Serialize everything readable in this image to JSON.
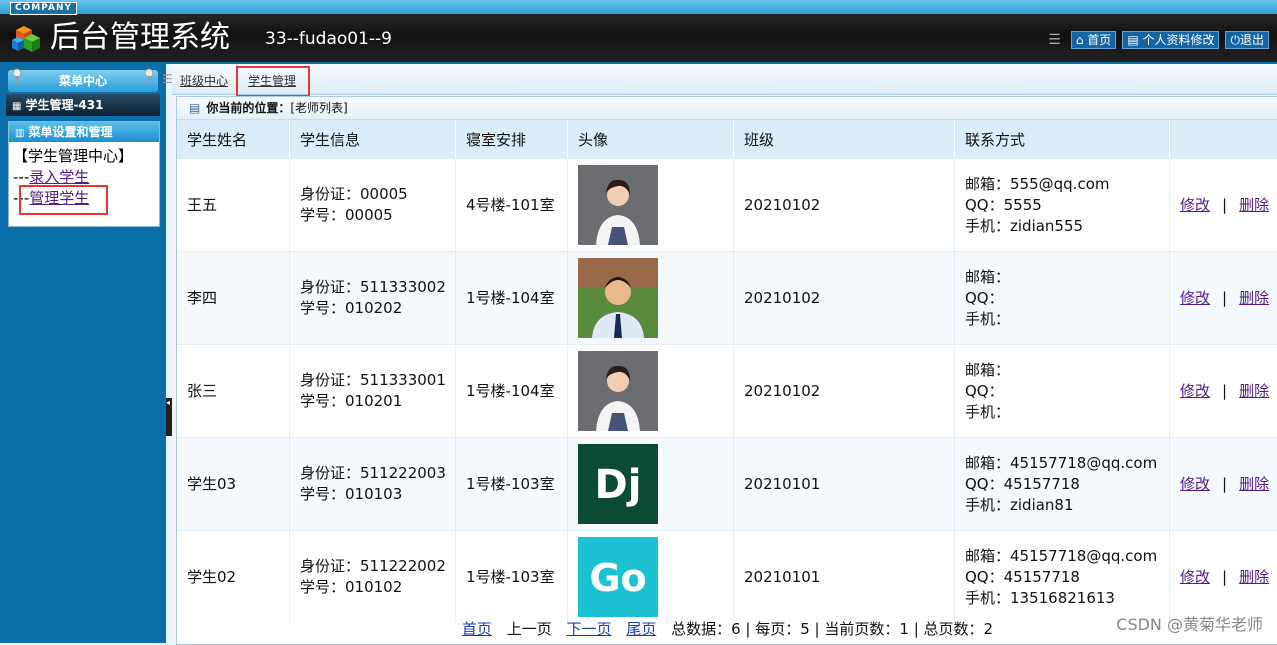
{
  "header": {
    "company": "COMPANY",
    "title": "后台管理系统",
    "user": "33--fudao01--9",
    "links": [
      "首页",
      "个人资料修改",
      "退出"
    ]
  },
  "sidebar": {
    "menu_center": "菜单中心",
    "module": "学生管理-431",
    "panel_title": "菜单设置和管理",
    "root": "【学生管理中心】",
    "items": [
      "录入学生",
      "管理学生"
    ]
  },
  "tabs": [
    "班级中心",
    "学生管理"
  ],
  "location": {
    "label": "你当前的位置：",
    "value": "[老师列表]"
  },
  "table": {
    "columns": [
      "学生姓名",
      "学生信息",
      "寝室安排",
      "头像",
      "班级",
      "联系方式",
      ""
    ],
    "rows": [
      {
        "name": "王五",
        "idcard": "身份证：00005",
        "sno": "学号：00005",
        "dorm": "4号楼-101室",
        "avatar": "woman-portrait",
        "class": "20210102",
        "email": "邮箱：555@qq.com",
        "qq": "QQ：5555",
        "phone": "手机：zidian555"
      },
      {
        "name": "李四",
        "idcard": "身份证：511333002",
        "sno": "学号：010202",
        "dorm": "1号楼-104室",
        "avatar": "man-portrait",
        "class": "20210102",
        "email": "邮箱：",
        "qq": "QQ：",
        "phone": "手机："
      },
      {
        "name": "张三",
        "idcard": "身份证：511333001",
        "sno": "学号：010201",
        "dorm": "1号楼-104室",
        "avatar": "woman-portrait",
        "class": "20210102",
        "email": "邮箱：",
        "qq": "QQ：",
        "phone": "手机："
      },
      {
        "name": "学生03",
        "idcard": "身份证：511222003",
        "sno": "学号：010103",
        "dorm": "1号楼-103室",
        "avatar": "dj-logo",
        "class": "20210101",
        "email": "邮箱：45157718@qq.com",
        "qq": "QQ：45157718",
        "phone": "手机：zidian81"
      },
      {
        "name": "学生02",
        "idcard": "身份证：511222002",
        "sno": "学号：010102",
        "dorm": "1号楼-103室",
        "avatar": "go-logo",
        "class": "20210101",
        "email": "邮箱：45157718@qq.com",
        "qq": "QQ：45157718",
        "phone": "手机：13516821613"
      }
    ],
    "edit_label": "修改",
    "sep": "|",
    "delete_label": "删除"
  },
  "pager": {
    "first": "首页",
    "prev": "上一页",
    "next": "下一页",
    "last": "尾页",
    "info": "总数据：6 | 每页：5 | 当前页数：1 | 总页数：2"
  },
  "logos": {
    "dj": "Dj",
    "go": "Go"
  },
  "watermark": "CSDN @黄菊华老师"
}
